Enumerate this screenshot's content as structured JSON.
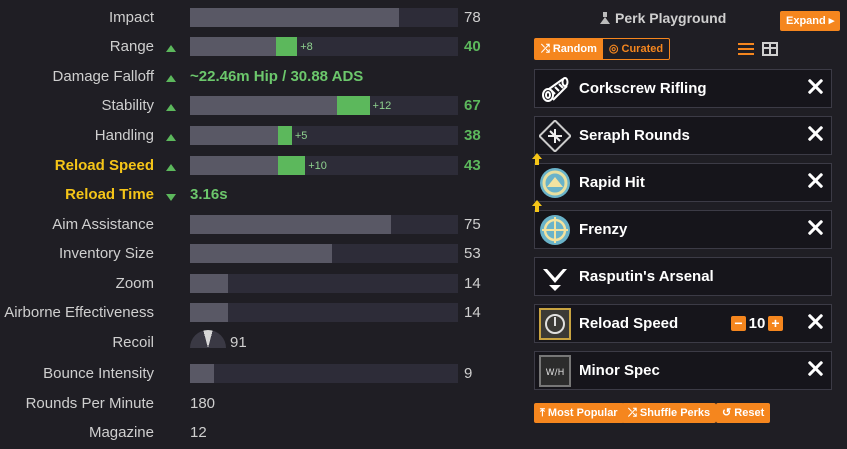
{
  "stats": [
    {
      "label": "Impact",
      "value": "78",
      "base": 0.78
    },
    {
      "label": "Range",
      "value": "40",
      "base": 0.32,
      "bonus": 0.08,
      "bonus_label": "+8",
      "up": true
    },
    {
      "label": "Damage Falloff",
      "text": "~22.46m Hip / 30.88 ADS",
      "up": true
    },
    {
      "label": "Stability",
      "value": "67",
      "base": 0.55,
      "bonus": 0.12,
      "bonus_label": "+12",
      "up": true
    },
    {
      "label": "Handling",
      "value": "38",
      "base": 0.33,
      "bonus": 0.05,
      "bonus_label": "+5",
      "up": true
    },
    {
      "label": "Reload Speed",
      "value": "43",
      "base": 0.33,
      "bonus": 0.1,
      "bonus_label": "+10",
      "up": true,
      "highlight": true
    },
    {
      "label": "Reload Time",
      "text": "3.16s",
      "down": true,
      "highlight": true
    },
    {
      "label": "Aim Assistance",
      "value": "75",
      "base": 0.75
    },
    {
      "label": "Inventory Size",
      "value": "53",
      "base": 0.53
    },
    {
      "label": "Zoom",
      "value": "14",
      "base": 0.14
    },
    {
      "label": "Airborne Effectiveness",
      "value": "14",
      "base": 0.14
    },
    {
      "label": "Recoil",
      "recoil": "91"
    },
    {
      "label": "Bounce Intensity",
      "value": "9",
      "base": 0.09
    },
    {
      "label": "Rounds Per Minute",
      "plain": "180"
    },
    {
      "label": "Magazine",
      "plain": "12"
    }
  ],
  "panel": {
    "title": "Perk Playground",
    "expand_label": "Expand ▸",
    "random_label": "⤮ Random",
    "curated_label": "◎ Curated",
    "most_popular_label": "⤒ Most Popular",
    "shuffle_label": "⤮ Shuffle Perks",
    "reset_label": "↺ Reset"
  },
  "perks": [
    {
      "name": "Corkscrew Rifling",
      "icon": "barrel-icon",
      "remove": true
    },
    {
      "name": "Seraph Rounds",
      "icon": "magazine-icon",
      "remove": true
    },
    {
      "name": "Rapid Hit",
      "icon": "rapid-hit-icon",
      "remove": true,
      "enhanced": true
    },
    {
      "name": "Frenzy",
      "icon": "frenzy-icon",
      "remove": true,
      "enhanced": true
    },
    {
      "name": "Rasputin's Arsenal",
      "icon": "rasputin-icon",
      "remove": false
    },
    {
      "name": "Reload Speed",
      "icon": "reload-masterwork-icon",
      "remove": true,
      "stepper": "10"
    },
    {
      "name": "Minor Spec",
      "icon": "minor-spec-icon",
      "remove": true
    }
  ],
  "colors": {
    "accent": "#f5861e",
    "bonus": "#5cb85c",
    "highlight": "#f5c518"
  }
}
